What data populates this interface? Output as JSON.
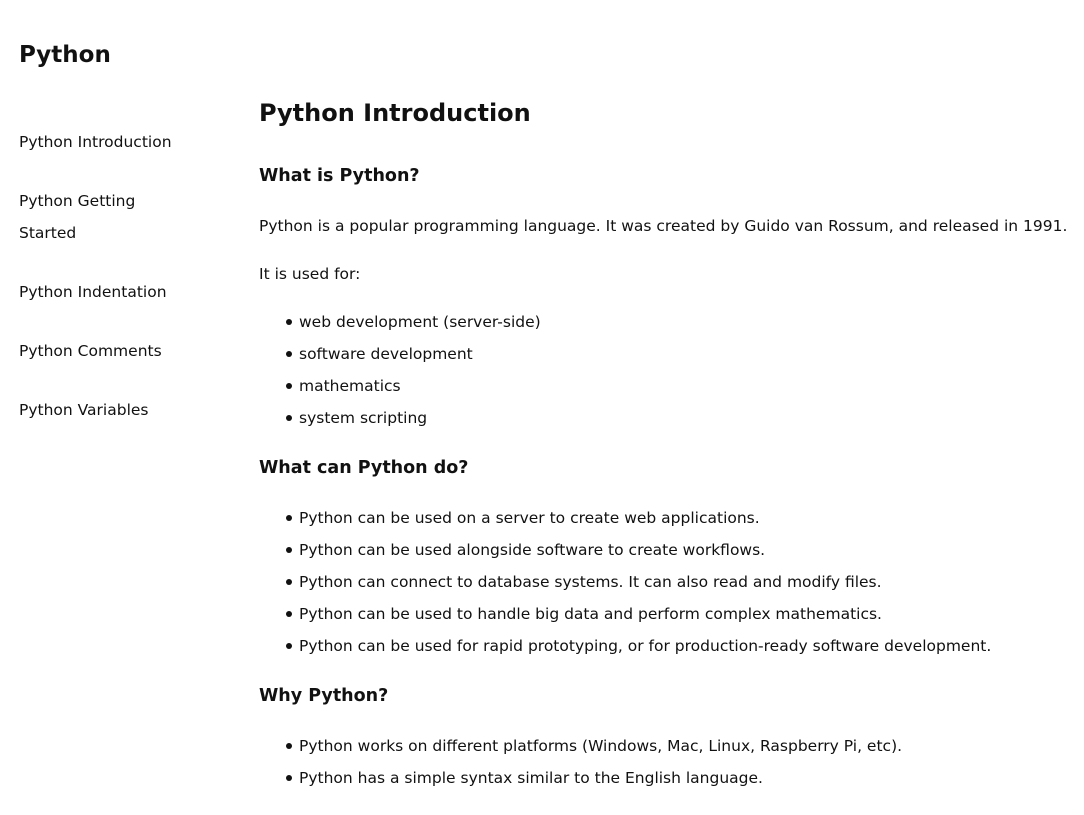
{
  "site": {
    "title": "Python"
  },
  "sidebar": {
    "items": [
      {
        "label": "Python Introduction"
      },
      {
        "label": "Python Getting Started"
      },
      {
        "label": "Python Indentation"
      },
      {
        "label": "Python Comments"
      },
      {
        "label": "Python Variables"
      }
    ]
  },
  "main": {
    "title": "Python Introduction",
    "sections": [
      {
        "heading": "What is Python?",
        "paragraphs": [
          "Python is a popular programming language. It was created by Guido van Rossum, and released in 1991.",
          "It is used for:"
        ],
        "bullets": [
          "web development (server-side)",
          "software development",
          "mathematics",
          "system scripting"
        ]
      },
      {
        "heading": "What can Python do?",
        "bullets": [
          "Python can be used on a server to create web applications.",
          "Python can be used alongside software to create workflows.",
          "Python can connect to database systems. It can also read and modify files.",
          "Python can be used to handle big data and perform complex mathematics.",
          "Python can be used for rapid prototyping, or for production-ready software development."
        ]
      },
      {
        "heading": "Why Python?",
        "bullets": [
          "Python works on different platforms (Windows, Mac, Linux, Raspberry Pi, etc).",
          "Python has a simple syntax similar to the English language."
        ]
      }
    ]
  }
}
